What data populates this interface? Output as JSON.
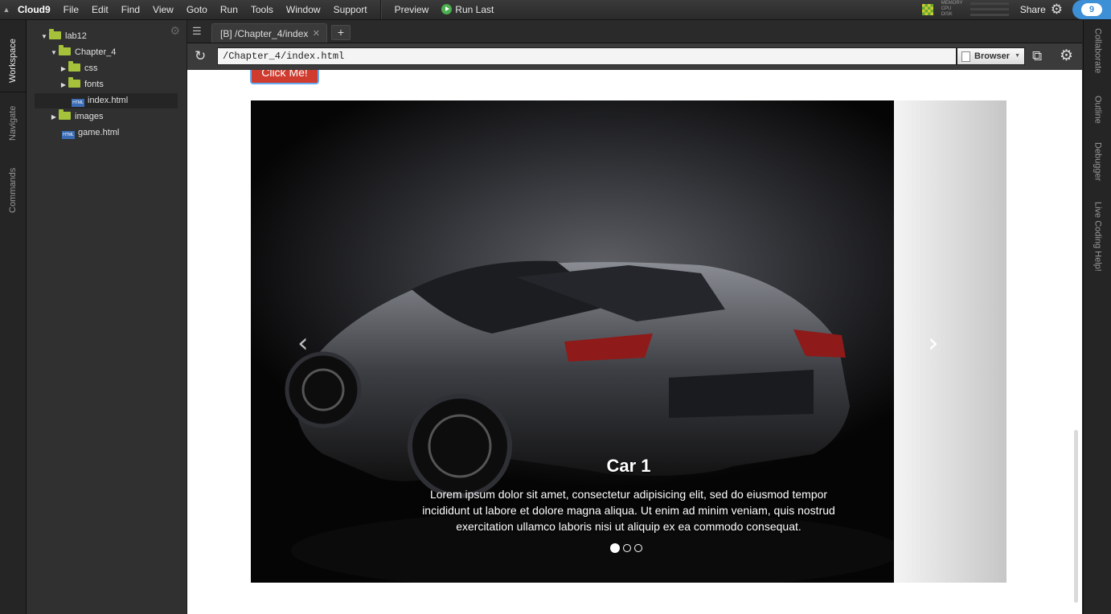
{
  "menubar": {
    "brand": "Cloud9",
    "items": [
      "File",
      "Edit",
      "Find",
      "View",
      "Goto",
      "Run",
      "Tools",
      "Window",
      "Support"
    ],
    "preview": "Preview",
    "run_last": "Run Last",
    "meters": [
      "MEMORY",
      "CPU",
      "DISK"
    ],
    "share": "Share"
  },
  "left_tabs": [
    "Workspace",
    "Navigate",
    "Commands"
  ],
  "tree": {
    "items": [
      {
        "label": "lab12",
        "type": "folder",
        "expanded": true
      },
      {
        "label": "Chapter_4",
        "type": "folder",
        "expanded": true
      },
      {
        "label": "css",
        "type": "folder",
        "expanded": false
      },
      {
        "label": "fonts",
        "type": "folder",
        "expanded": false
      },
      {
        "label": "index.html",
        "type": "file",
        "selected": true
      },
      {
        "label": "images",
        "type": "folder",
        "expanded": false
      },
      {
        "label": "game.html",
        "type": "file"
      }
    ],
    "file_badge": "HTML"
  },
  "editor": {
    "tab_title": "[B] /Chapter_4/index",
    "url": "/Chapter_4/index.html",
    "browser_select": "Browser"
  },
  "preview": {
    "button_label": "Click Me!",
    "caption_title": "Car 1",
    "caption_text": "Lorem ipsum dolor sit amet, consectetur adipisicing elit, sed do eiusmod tempor incididunt ut labore et dolore magna aliqua. Ut enim ad minim veniam, quis nostrud exercitation ullamco laboris nisi ut aliquip ex ea commodo consequat.",
    "slides_count": 3,
    "active_slide": 1
  },
  "right_tabs": [
    "Collaborate",
    "Outline",
    "Debugger",
    "Live Coding Help!"
  ],
  "colors": {
    "accent": "#3d8fd6",
    "folder": "#a6c23a",
    "button": "#cf3b2f"
  }
}
